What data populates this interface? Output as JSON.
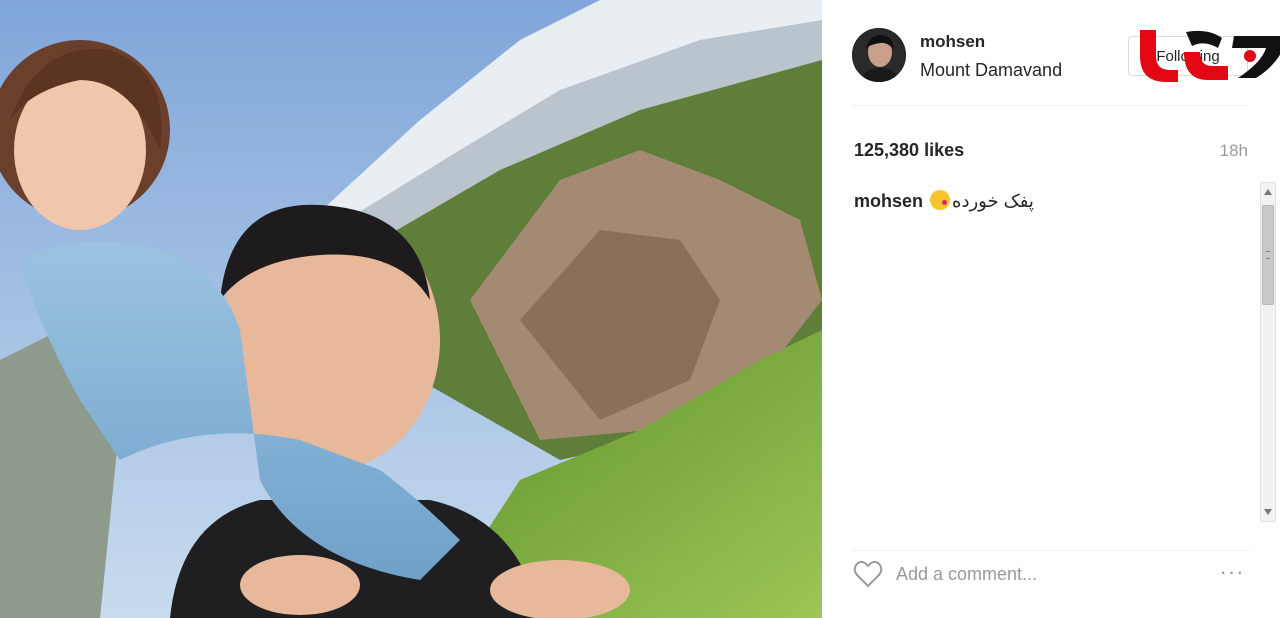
{
  "post": {
    "username": "mohsen",
    "location": "Mount Damavand",
    "follow_label": "Following",
    "likes": "125,380 likes",
    "time": "18h",
    "caption": {
      "user": "mohsen",
      "text": "پفک خورده",
      "emoji": "kissing-face-emoji"
    },
    "comment_placeholder": "Add a comment...",
    "more_label": "···"
  },
  "brand": {
    "logo_text": "rokna",
    "logo_colors": [
      "#e30613",
      "#111111"
    ]
  }
}
